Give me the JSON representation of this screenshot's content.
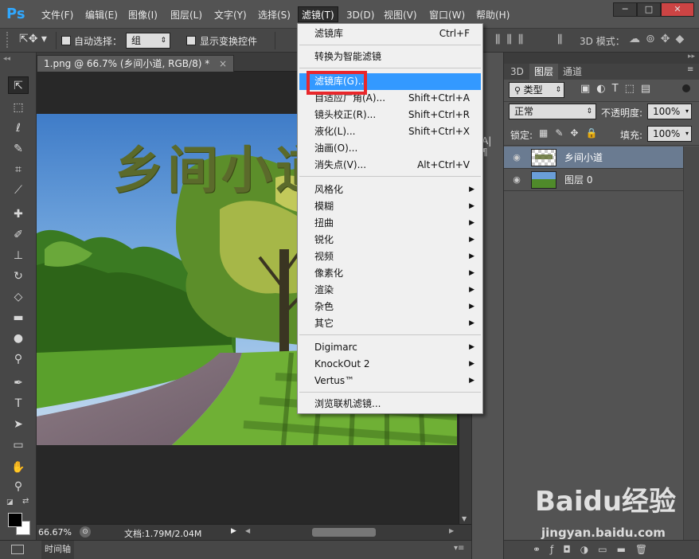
{
  "menubar": {
    "logo": "Ps",
    "items": [
      "文件(F)",
      "编辑(E)",
      "图像(I)",
      "图层(L)",
      "文字(Y)",
      "选择(S)",
      "滤镜(T)",
      "3D(D)",
      "视图(V)",
      "窗口(W)",
      "帮助(H)"
    ],
    "window_buttons": [
      "─",
      "□",
      "✕"
    ]
  },
  "options_bar": {
    "auto_select_label": "自动选择：",
    "auto_select_value": "组",
    "show_transform_label": "显示变换控件",
    "mode_3d_label": "3D 模式："
  },
  "document": {
    "tab_title": "1.png @ 66.7% (乡间小道, RGB/8) *",
    "tab_close": "×",
    "photo_text": "乡间小道"
  },
  "status": {
    "zoom": "66.67%",
    "doc_size": "文档:1.79M/2.04M"
  },
  "timeline": {
    "label": "时间轴"
  },
  "filter_menu": {
    "groups": [
      [
        {
          "label": "滤镜库",
          "shortcut": "Ctrl+F"
        }
      ],
      [
        {
          "label": "转换为智能滤镜",
          "shortcut": ""
        }
      ],
      [
        {
          "label": "滤镜库(G)...",
          "shortcut": "",
          "highlighted": true
        },
        {
          "label": "自适应广角(A)...",
          "shortcut": "Shift+Ctrl+A"
        },
        {
          "label": "镜头校正(R)...",
          "shortcut": "Shift+Ctrl+R"
        },
        {
          "label": "液化(L)...",
          "shortcut": "Shift+Ctrl+X"
        },
        {
          "label": "油画(O)...",
          "shortcut": ""
        },
        {
          "label": "消失点(V)...",
          "shortcut": "Alt+Ctrl+V"
        }
      ],
      [
        {
          "label": "风格化",
          "submenu": true
        },
        {
          "label": "模糊",
          "submenu": true
        },
        {
          "label": "扭曲",
          "submenu": true
        },
        {
          "label": "锐化",
          "submenu": true
        },
        {
          "label": "视频",
          "submenu": true
        },
        {
          "label": "像素化",
          "submenu": true
        },
        {
          "label": "渲染",
          "submenu": true
        },
        {
          "label": "杂色",
          "submenu": true
        },
        {
          "label": "其它",
          "submenu": true
        }
      ],
      [
        {
          "label": "Digimarc",
          "submenu": true
        },
        {
          "label": "KnockOut 2",
          "submenu": true
        },
        {
          "label": "Vertus™",
          "submenu": true
        }
      ],
      [
        {
          "label": "浏览联机滤镜...",
          "shortcut": ""
        }
      ]
    ]
  },
  "layers_panel": {
    "tabs": [
      "3D",
      "图层",
      "通道"
    ],
    "active_tab": "图层",
    "filter_label": "类型",
    "blend_mode": "正常",
    "opacity_label": "不透明度:",
    "opacity_value": "100%",
    "lock_label": "锁定:",
    "fill_label": "填充:",
    "fill_value": "100%",
    "layers": [
      {
        "name": "乡间小道",
        "selected": true
      },
      {
        "name": "图层 0",
        "selected": false
      }
    ]
  },
  "watermark": {
    "brand": "Baidu经验",
    "url": "jingyan.baidu.com"
  },
  "colors": {
    "menu_highlight": "#3399ff",
    "selected_layer": "#6a7b91",
    "callout_box": "#e8272b",
    "photo_text": "#5b6a2b"
  }
}
